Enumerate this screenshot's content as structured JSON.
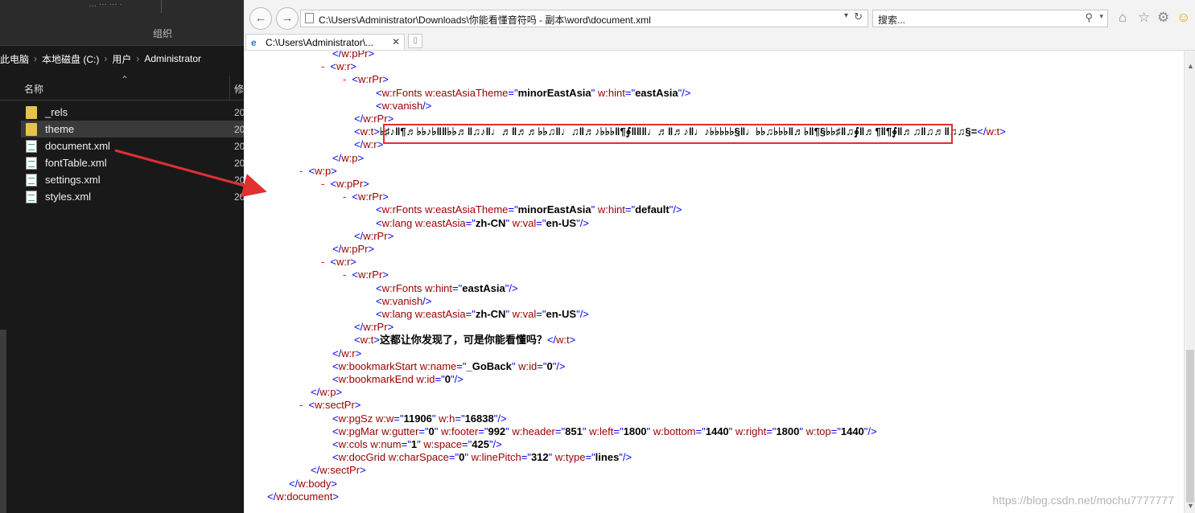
{
  "explorer": {
    "ribbon_group_label": "组织",
    "ribbon_top_text": "… ··· ···    ·",
    "breadcrumb": [
      "此电脑",
      "本地磁盘 (C:)",
      "用户",
      "Administrator"
    ],
    "breadcrumb_sep": "›",
    "columns": {
      "name": "名称",
      "modified": "修"
    },
    "files": [
      {
        "name": "_rels",
        "type": "folder",
        "date": "20",
        "selected": false
      },
      {
        "name": "theme",
        "type": "folder",
        "date": "20",
        "selected": true
      },
      {
        "name": "document.xml",
        "type": "xml",
        "date": "20",
        "selected": false
      },
      {
        "name": "fontTable.xml",
        "type": "xml",
        "date": "20",
        "selected": false
      },
      {
        "name": "settings.xml",
        "type": "xml",
        "date": "20",
        "selected": false
      },
      {
        "name": "styles.xml",
        "type": "xml",
        "date": "20",
        "selected": false
      }
    ]
  },
  "ie": {
    "address": "C:\\Users\\Administrator\\Downloads\\你能看懂音符吗 - 副本\\word\\document.xml",
    "search_placeholder": "搜索...",
    "tab_title": "C:\\Users\\Administrator\\...",
    "icons": [
      "back-icon",
      "forward-icon",
      "home-icon",
      "star-icon",
      "gear-icon",
      "smiley-icon"
    ]
  },
  "xml_lines": [
    {
      "indent": 3,
      "minus": false,
      "parts": [
        [
          "b",
          "</"
        ],
        [
          "t",
          "w:pPr"
        ],
        [
          "b",
          ">"
        ]
      ]
    },
    {
      "indent": 3,
      "minus": true,
      "parts": [
        [
          "b",
          "<"
        ],
        [
          "t",
          "w:r"
        ],
        [
          "b",
          ">"
        ]
      ]
    },
    {
      "indent": 4,
      "minus": true,
      "parts": [
        [
          "b",
          "<"
        ],
        [
          "t",
          "w:rPr"
        ],
        [
          "b",
          ">"
        ]
      ]
    },
    {
      "indent": 5,
      "minus": false,
      "parts": [
        [
          "b",
          "<"
        ],
        [
          "t",
          "w:rFonts "
        ],
        [
          "a",
          "w:eastAsiaTheme"
        ],
        [
          "b",
          "=\""
        ],
        [
          "v",
          "minorEastAsia"
        ],
        [
          "b",
          "\" "
        ],
        [
          "a",
          "w:hint"
        ],
        [
          "b",
          "=\""
        ],
        [
          "v",
          "eastAsia"
        ],
        [
          "b",
          "\"/>"
        ]
      ]
    },
    {
      "indent": 5,
      "minus": false,
      "parts": [
        [
          "b",
          "<"
        ],
        [
          "t",
          "w:vanish"
        ],
        [
          "b",
          "/>"
        ]
      ]
    },
    {
      "indent": 4,
      "minus": false,
      "parts": [
        [
          "b",
          "</"
        ],
        [
          "t",
          "w:rPr"
        ],
        [
          "b",
          ">"
        ]
      ]
    },
    {
      "indent": 4,
      "minus": false,
      "parts": [
        [
          "b",
          "<"
        ],
        [
          "t",
          "w:t"
        ],
        [
          "b",
          ">"
        ],
        [
          "v",
          "♭♯♪‖¶♬♭♭♪♭‖‖♭♭♬‖♫♪‖♩♬‖♬♬♭♭♫‖♩♫‖♬♪♭♭♭‖¶∮‖‖‖♩♬‖♬♪‖♩♪♭♭♭♭♭§‖♩♭♭♫♭♭♭‖♬♭‖¶§♭♭♯‖♫∮‖♬¶‖¶∮‖♬♫‖♫♬‖♫♫§="
        ],
        [
          "b",
          "</"
        ],
        [
          "t",
          "w:t"
        ],
        [
          "b",
          ">"
        ]
      ]
    },
    {
      "indent": 4,
      "minus": false,
      "parts": [
        [
          "b",
          "</"
        ],
        [
          "t",
          "w:r"
        ],
        [
          "b",
          ">"
        ]
      ]
    },
    {
      "indent": 3,
      "minus": false,
      "parts": [
        [
          "b",
          "</"
        ],
        [
          "t",
          "w:p"
        ],
        [
          "b",
          ">"
        ]
      ]
    },
    {
      "indent": 2,
      "minus": true,
      "parts": [
        [
          "b",
          "<"
        ],
        [
          "t",
          "w:p"
        ],
        [
          "b",
          ">"
        ]
      ]
    },
    {
      "indent": 3,
      "minus": true,
      "parts": [
        [
          "b",
          "<"
        ],
        [
          "t",
          "w:pPr"
        ],
        [
          "b",
          ">"
        ]
      ]
    },
    {
      "indent": 4,
      "minus": true,
      "parts": [
        [
          "b",
          "<"
        ],
        [
          "t",
          "w:rPr"
        ],
        [
          "b",
          ">"
        ]
      ]
    },
    {
      "indent": 5,
      "minus": false,
      "parts": [
        [
          "b",
          "<"
        ],
        [
          "t",
          "w:rFonts "
        ],
        [
          "a",
          "w:eastAsiaTheme"
        ],
        [
          "b",
          "=\""
        ],
        [
          "v",
          "minorEastAsia"
        ],
        [
          "b",
          "\" "
        ],
        [
          "a",
          "w:hint"
        ],
        [
          "b",
          "=\""
        ],
        [
          "v",
          "default"
        ],
        [
          "b",
          "\"/>"
        ]
      ]
    },
    {
      "indent": 5,
      "minus": false,
      "parts": [
        [
          "b",
          "<"
        ],
        [
          "t",
          "w:lang "
        ],
        [
          "a",
          "w:eastAsia"
        ],
        [
          "b",
          "=\""
        ],
        [
          "v",
          "zh-CN"
        ],
        [
          "b",
          "\" "
        ],
        [
          "a",
          "w:val"
        ],
        [
          "b",
          "=\""
        ],
        [
          "v",
          "en-US"
        ],
        [
          "b",
          "\"/>"
        ]
      ]
    },
    {
      "indent": 4,
      "minus": false,
      "parts": [
        [
          "b",
          "</"
        ],
        [
          "t",
          "w:rPr"
        ],
        [
          "b",
          ">"
        ]
      ]
    },
    {
      "indent": 3,
      "minus": false,
      "parts": [
        [
          "b",
          "</"
        ],
        [
          "t",
          "w:pPr"
        ],
        [
          "b",
          ">"
        ]
      ]
    },
    {
      "indent": 3,
      "minus": true,
      "parts": [
        [
          "b",
          "<"
        ],
        [
          "t",
          "w:r"
        ],
        [
          "b",
          ">"
        ]
      ]
    },
    {
      "indent": 4,
      "minus": true,
      "parts": [
        [
          "b",
          "<"
        ],
        [
          "t",
          "w:rPr"
        ],
        [
          "b",
          ">"
        ]
      ]
    },
    {
      "indent": 5,
      "minus": false,
      "parts": [
        [
          "b",
          "<"
        ],
        [
          "t",
          "w:rFonts "
        ],
        [
          "a",
          "w:hint"
        ],
        [
          "b",
          "=\""
        ],
        [
          "v",
          "eastAsia"
        ],
        [
          "b",
          "\"/>"
        ]
      ]
    },
    {
      "indent": 5,
      "minus": false,
      "parts": [
        [
          "b",
          "<"
        ],
        [
          "t",
          "w:vanish"
        ],
        [
          "b",
          "/>"
        ]
      ]
    },
    {
      "indent": 5,
      "minus": false,
      "parts": [
        [
          "b",
          "<"
        ],
        [
          "t",
          "w:lang "
        ],
        [
          "a",
          "w:eastAsia"
        ],
        [
          "b",
          "=\""
        ],
        [
          "v",
          "zh-CN"
        ],
        [
          "b",
          "\" "
        ],
        [
          "a",
          "w:val"
        ],
        [
          "b",
          "=\""
        ],
        [
          "v",
          "en-US"
        ],
        [
          "b",
          "\"/>"
        ]
      ]
    },
    {
      "indent": 4,
      "minus": false,
      "parts": [
        [
          "b",
          "</"
        ],
        [
          "t",
          "w:rPr"
        ],
        [
          "b",
          ">"
        ]
      ]
    },
    {
      "indent": 4,
      "minus": false,
      "parts": [
        [
          "b",
          "<"
        ],
        [
          "t",
          "w:t"
        ],
        [
          "b",
          ">"
        ],
        [
          "v",
          "这都让你发现了，可是你能看懂吗？"
        ],
        [
          "b",
          "</"
        ],
        [
          "t",
          "w:t"
        ],
        [
          "b",
          ">"
        ]
      ]
    },
    {
      "indent": 3,
      "minus": false,
      "parts": [
        [
          "b",
          "</"
        ],
        [
          "t",
          "w:r"
        ],
        [
          "b",
          ">"
        ]
      ]
    },
    {
      "indent": 3,
      "minus": false,
      "parts": [
        [
          "b",
          "<"
        ],
        [
          "t",
          "w:bookmarkStart "
        ],
        [
          "a",
          "w:name"
        ],
        [
          "b",
          "=\""
        ],
        [
          "v",
          "_GoBack"
        ],
        [
          "b",
          "\" "
        ],
        [
          "a",
          "w:id"
        ],
        [
          "b",
          "=\""
        ],
        [
          "v",
          "0"
        ],
        [
          "b",
          "\"/>"
        ]
      ]
    },
    {
      "indent": 3,
      "minus": false,
      "parts": [
        [
          "b",
          "<"
        ],
        [
          "t",
          "w:bookmarkEnd "
        ],
        [
          "a",
          "w:id"
        ],
        [
          "b",
          "=\""
        ],
        [
          "v",
          "0"
        ],
        [
          "b",
          "\"/>"
        ]
      ]
    },
    {
      "indent": 2,
      "minus": false,
      "parts": [
        [
          "b",
          "</"
        ],
        [
          "t",
          "w:p"
        ],
        [
          "b",
          ">"
        ]
      ]
    },
    {
      "indent": 2,
      "minus": true,
      "parts": [
        [
          "b",
          "<"
        ],
        [
          "t",
          "w:sectPr"
        ],
        [
          "b",
          ">"
        ]
      ]
    },
    {
      "indent": 3,
      "minus": false,
      "parts": [
        [
          "b",
          "<"
        ],
        [
          "t",
          "w:pgSz "
        ],
        [
          "a",
          "w:w"
        ],
        [
          "b",
          "=\""
        ],
        [
          "v",
          "11906"
        ],
        [
          "b",
          "\" "
        ],
        [
          "a",
          "w:h"
        ],
        [
          "b",
          "=\""
        ],
        [
          "v",
          "16838"
        ],
        [
          "b",
          "\"/>"
        ]
      ]
    },
    {
      "indent": 3,
      "minus": false,
      "parts": [
        [
          "b",
          "<"
        ],
        [
          "t",
          "w:pgMar "
        ],
        [
          "a",
          "w:gutter"
        ],
        [
          "b",
          "=\""
        ],
        [
          "v",
          "0"
        ],
        [
          "b",
          "\" "
        ],
        [
          "a",
          "w:footer"
        ],
        [
          "b",
          "=\""
        ],
        [
          "v",
          "992"
        ],
        [
          "b",
          "\" "
        ],
        [
          "a",
          "w:header"
        ],
        [
          "b",
          "=\""
        ],
        [
          "v",
          "851"
        ],
        [
          "b",
          "\" "
        ],
        [
          "a",
          "w:left"
        ],
        [
          "b",
          "=\""
        ],
        [
          "v",
          "1800"
        ],
        [
          "b",
          "\" "
        ],
        [
          "a",
          "w:bottom"
        ],
        [
          "b",
          "=\""
        ],
        [
          "v",
          "1440"
        ],
        [
          "b",
          "\" "
        ],
        [
          "a",
          "w:right"
        ],
        [
          "b",
          "=\""
        ],
        [
          "v",
          "1800"
        ],
        [
          "b",
          "\" "
        ],
        [
          "a",
          "w:top"
        ],
        [
          "b",
          "=\""
        ],
        [
          "v",
          "1440"
        ],
        [
          "b",
          "\"/>"
        ]
      ]
    },
    {
      "indent": 3,
      "minus": false,
      "parts": [
        [
          "b",
          "<"
        ],
        [
          "t",
          "w:cols "
        ],
        [
          "a",
          "w:num"
        ],
        [
          "b",
          "=\""
        ],
        [
          "v",
          "1"
        ],
        [
          "b",
          "\" "
        ],
        [
          "a",
          "w:space"
        ],
        [
          "b",
          "=\""
        ],
        [
          "v",
          "425"
        ],
        [
          "b",
          "\"/>"
        ]
      ]
    },
    {
      "indent": 3,
      "minus": false,
      "parts": [
        [
          "b",
          "<"
        ],
        [
          "t",
          "w:docGrid "
        ],
        [
          "a",
          "w:charSpace"
        ],
        [
          "b",
          "=\""
        ],
        [
          "v",
          "0"
        ],
        [
          "b",
          "\" "
        ],
        [
          "a",
          "w:linePitch"
        ],
        [
          "b",
          "=\""
        ],
        [
          "v",
          "312"
        ],
        [
          "b",
          "\" "
        ],
        [
          "a",
          "w:type"
        ],
        [
          "b",
          "=\""
        ],
        [
          "v",
          "lines"
        ],
        [
          "b",
          "\"/>"
        ]
      ]
    },
    {
      "indent": 2,
      "minus": false,
      "parts": [
        [
          "b",
          "</"
        ],
        [
          "t",
          "w:sectPr"
        ],
        [
          "b",
          ">"
        ]
      ]
    },
    {
      "indent": 1,
      "minus": false,
      "parts": [
        [
          "b",
          "</"
        ],
        [
          "t",
          "w:body"
        ],
        [
          "b",
          ">"
        ]
      ]
    },
    {
      "indent": 0,
      "minus": false,
      "parts": [
        [
          "b",
          "</"
        ],
        [
          "t",
          "w:document"
        ],
        [
          "b",
          ">"
        ]
      ]
    }
  ],
  "minus_glyph": "-",
  "watermark": "https://blog.csdn.net/mochu7777777",
  "colors": {
    "highlight_box": "#e03030",
    "arrow": "#e03030",
    "tag": "#990000",
    "bracket": "#0000ff"
  }
}
